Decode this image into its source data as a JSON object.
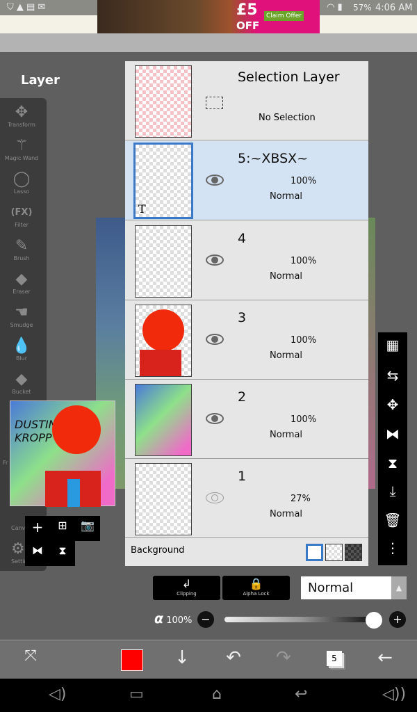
{
  "status": {
    "time": "4:06 AM",
    "battery": "57%"
  },
  "ad": {
    "price": "£5",
    "off": "OFF",
    "cta": "Claim Offer"
  },
  "title": "Layer",
  "tools": [
    {
      "label": "Transform",
      "icon": "move-icon"
    },
    {
      "label": "Magic Wand",
      "icon": "magic-wand-icon"
    },
    {
      "label": "Lasso",
      "icon": "lasso-icon"
    },
    {
      "label": "Filter",
      "icon": "fx-icon"
    },
    {
      "label": "Brush",
      "icon": "brush-icon"
    },
    {
      "label": "Eraser",
      "icon": "eraser-icon"
    },
    {
      "label": "Smudge",
      "icon": "smudge-icon"
    },
    {
      "label": "Blur",
      "icon": "blur-icon"
    },
    {
      "label": "Bucket",
      "icon": "bucket-icon"
    },
    {
      "label": "Fr"
    },
    {
      "label": "Canv"
    },
    {
      "label": "Settin"
    }
  ],
  "thumbnail_text": "DUSTIN KROPP",
  "layers": {
    "selection": {
      "name": "Selection Layer",
      "status": "No Selection"
    },
    "items": [
      {
        "name": "5:~XBSX~",
        "opacity": "100%",
        "mode": "Normal",
        "visible": true,
        "selected": true,
        "badge": "T"
      },
      {
        "name": "4",
        "opacity": "100%",
        "mode": "Normal",
        "visible": true
      },
      {
        "name": "3",
        "opacity": "100%",
        "mode": "Normal",
        "visible": true
      },
      {
        "name": "2",
        "opacity": "100%",
        "mode": "Normal",
        "visible": true
      },
      {
        "name": "1",
        "opacity": "27%",
        "mode": "Normal",
        "visible": false
      }
    ],
    "background": "Background"
  },
  "controls": {
    "clipping": "Clipping",
    "alpha_lock": "Alpha Lock",
    "blend_mode": "Normal",
    "alpha_symbol": "α",
    "opacity": "100%",
    "opacity_value": 1.0
  },
  "bottom": {
    "layer_count": "5",
    "color": "#ff0000"
  }
}
